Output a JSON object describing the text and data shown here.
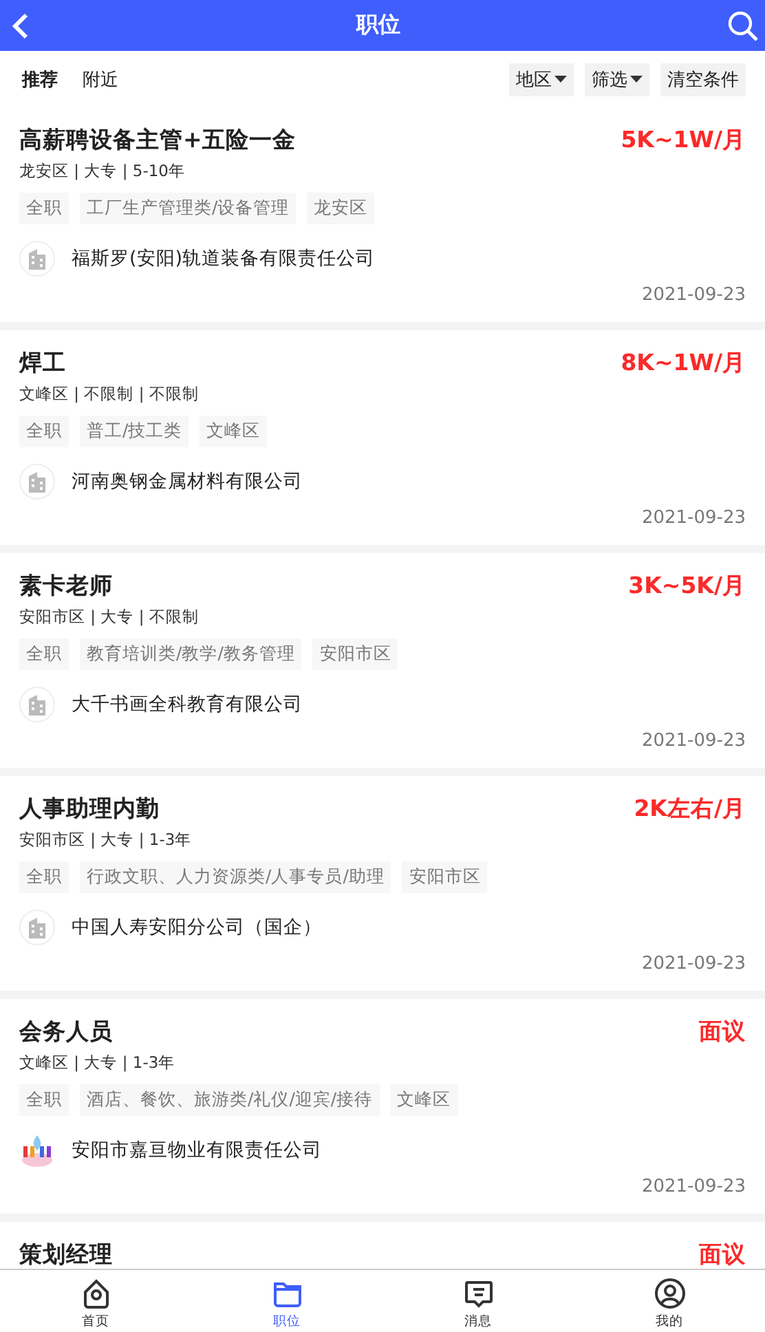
{
  "header": {
    "title": "职位"
  },
  "tabs": [
    {
      "label": "推荐",
      "selected": true
    },
    {
      "label": "附近",
      "selected": false
    }
  ],
  "filters": [
    {
      "label": "地区",
      "kind": "dropdown"
    },
    {
      "label": "筛选",
      "kind": "dropdown"
    },
    {
      "label": "清空条件",
      "kind": "button"
    }
  ],
  "jobs": [
    {
      "title": "高薪聘设备主管+五险一金",
      "salary": "5K~1W/月",
      "meta": "龙安区 | 大专 | 5-10年",
      "tags": [
        "全职",
        "工厂生产管理类/设备管理",
        "龙安区"
      ],
      "company": "福斯罗(安阳)轨道装备有限责任公司",
      "kind": "building",
      "date": "2021-09-23"
    },
    {
      "title": "焊工",
      "salary": "8K~1W/月",
      "meta": "文峰区 | 不限制 | 不限制",
      "tags": [
        "全职",
        "普工/技工类",
        "文峰区"
      ],
      "company": "河南奥钢金属材料有限公司",
      "kind": "building",
      "date": "2021-09-23"
    },
    {
      "title": "素卡老师",
      "salary": "3K~5K/月",
      "meta": "安阳市区 | 大专 | 不限制",
      "tags": [
        "全职",
        "教育培训类/教学/教务管理",
        "安阳市区"
      ],
      "company": "大千书画全科教育有限公司",
      "kind": "building",
      "date": "2021-09-23"
    },
    {
      "title": "人事助理内勤",
      "salary": "2K左右/月",
      "meta": "安阳市区 | 大专 | 1-3年",
      "tags": [
        "全职",
        "行政文职、人力资源类/人事专员/助理",
        "安阳市区"
      ],
      "company": "中国人寿安阳分公司（国企）",
      "kind": "building",
      "date": "2021-09-23"
    },
    {
      "title": "会务人员",
      "salary": "面议",
      "meta": "文峰区 | 大专 | 1-3年",
      "tags": [
        "全职",
        "酒店、餐饮、旅游类/礼仪/迎宾/接待",
        "文峰区"
      ],
      "company": "安阳市嘉亘物业有限责任公司",
      "kind": "emblem",
      "date": "2021-09-23"
    },
    {
      "title": "策划经理",
      "salary": "面议"
    }
  ],
  "nav": [
    {
      "label": "首页",
      "selected": false
    },
    {
      "label": "职位",
      "selected": true
    },
    {
      "label": "消息",
      "selected": false
    },
    {
      "label": "我的",
      "selected": false
    }
  ]
}
